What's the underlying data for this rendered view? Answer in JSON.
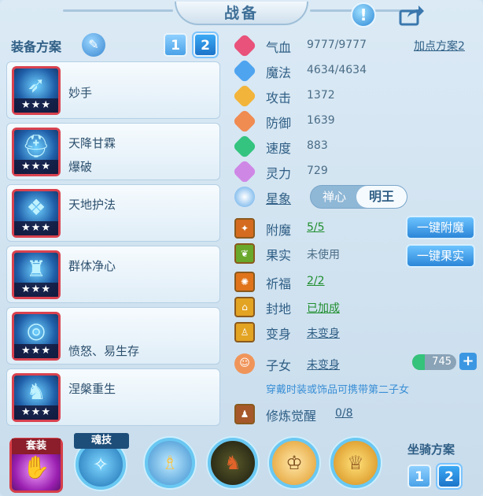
{
  "header": {
    "title": "战备",
    "info_icon": "exclamation-icon",
    "share_icon": "share-icon"
  },
  "scheme": {
    "title": "装备方案",
    "buttons": [
      "1",
      "2"
    ],
    "selected": "2"
  },
  "equipment": [
    {
      "stars": "★★★",
      "skills": [
        "妙手"
      ]
    },
    {
      "stars": "★★★",
      "skills": [
        "天降甘霖",
        "爆破"
      ]
    },
    {
      "stars": "★★★",
      "skills": [
        "天地护法"
      ]
    },
    {
      "stars": "★★★",
      "skills": [
        "群体净心"
      ]
    },
    {
      "stars": "★★★",
      "skills": [
        "",
        "愤怒、易生存"
      ]
    },
    {
      "stars": "★★★",
      "skills": [
        "涅槃重生"
      ]
    }
  ],
  "stats": {
    "plan_link": "加点方案2",
    "items": [
      {
        "label": "气血",
        "value": "9777/9777",
        "color": "#e9527b"
      },
      {
        "label": "魔法",
        "value": "4634/4634",
        "color": "#4fa4f0"
      },
      {
        "label": "攻击",
        "value": "1372",
        "color": "#f2b43a"
      },
      {
        "label": "防御",
        "value": "1639",
        "color": "#f08b52"
      },
      {
        "label": "速度",
        "value": "883",
        "color": "#34c47f"
      },
      {
        "label": "灵力",
        "value": "729",
        "color": "#cf87e6"
      }
    ]
  },
  "xingxiang": {
    "label": "星象",
    "opt1": "禅心",
    "opt2": "明王",
    "selected": "明王"
  },
  "extras": {
    "fumo": {
      "label": "附魔",
      "value": "5/5"
    },
    "guoshi": {
      "label": "果实",
      "value": "未使用"
    },
    "qifu": {
      "label": "祈福",
      "value": "2/2"
    },
    "fengdi": {
      "label": "封地",
      "value": "已加成"
    },
    "bianshen": {
      "label": "变身",
      "value": "未变身"
    },
    "zinv": {
      "label": "子女",
      "value": "未变身"
    },
    "xiulian": {
      "label": "修炼觉醒",
      "value": "0/8"
    }
  },
  "buttons": {
    "one_key_fumo": "一键附魔",
    "one_key_guoshi": "一键果实"
  },
  "hint": "穿戴时装或饰品可携带第二子女",
  "child_count": "745",
  "bottom": {
    "set_label": "套装",
    "soul_label": "魂技",
    "mount_title": "坐骑方案",
    "mount_buttons": [
      "1",
      "2"
    ],
    "mount_selected": "2"
  }
}
